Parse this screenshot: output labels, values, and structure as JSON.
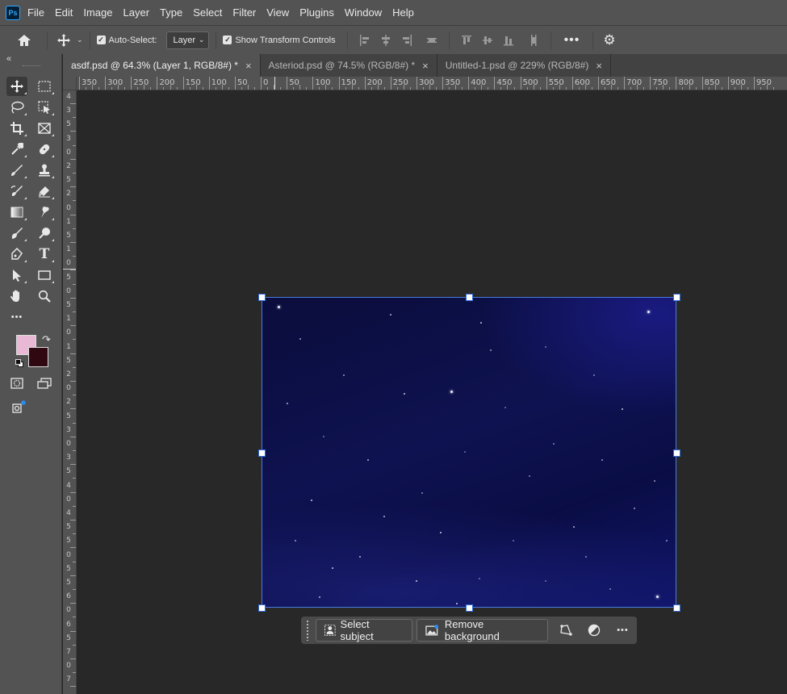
{
  "app": {
    "logo_text": "Ps"
  },
  "menu": [
    "File",
    "Edit",
    "Image",
    "Layer",
    "Type",
    "Select",
    "Filter",
    "View",
    "Plugins",
    "Window",
    "Help"
  ],
  "options_bar": {
    "auto_select_label": "Auto-Select:",
    "auto_select_checked": true,
    "layer_select_value": "Layer",
    "show_transform_label": "Show Transform Controls",
    "show_transform_checked": true
  },
  "tabs": [
    {
      "label": "asdf.psd @ 64.3% (Layer 1, RGB/8#) *",
      "active": true
    },
    {
      "label": "Asteriod.psd @ 74.5% (RGB/8#) *",
      "active": false
    },
    {
      "label": "Untitled-1.psd @ 229% (RGB/8#)",
      "active": false
    }
  ],
  "ruler_h_labels": [
    "350",
    "300",
    "250",
    "200",
    "150",
    "100",
    "50",
    "0",
    "50",
    "100",
    "150",
    "200",
    "250",
    "300",
    "350",
    "400",
    "450",
    "500",
    "550",
    "600",
    "650",
    "700",
    "750",
    "800",
    "850",
    "900",
    "950"
  ],
  "ruler_v_labels": [
    "4",
    "3",
    "5",
    "3",
    "0",
    "2",
    "5",
    "2",
    "0",
    "1",
    "5",
    "1",
    "0",
    "5",
    "0",
    "5",
    "1",
    "0",
    "1",
    "5",
    "2",
    "0",
    "2",
    "5",
    "3",
    "0",
    "3",
    "5",
    "4",
    "0",
    "4",
    "5",
    "5",
    "0",
    "5",
    "5",
    "6",
    "0",
    "6",
    "5",
    "7",
    "0",
    "7"
  ],
  "colors": {
    "foreground": "#e8b8d4",
    "background": "#300812",
    "selection": "#4a7adf"
  },
  "task_bar": {
    "select_subject": "Select subject",
    "remove_background": "Remove background"
  },
  "tool_icons": [
    "move-tool-icon",
    "marquee-tool-icon",
    "lasso-tool-icon",
    "object-select-tool-icon",
    "crop-tool-icon",
    "frame-tool-icon",
    "eyedropper-tool-icon",
    "healing-brush-icon",
    "brush-tool-icon",
    "clone-stamp-icon",
    "history-brush-icon",
    "eraser-icon",
    "gradient-tool-icon",
    "smudge-tool-icon",
    "blur-tool-icon",
    "dodge-tool-icon",
    "pen-tool-icon",
    "type-tool-icon",
    "path-select-icon",
    "rectangle-tool-icon",
    "hand-tool-icon",
    "zoom-tool-icon",
    "more-tools-icon"
  ]
}
